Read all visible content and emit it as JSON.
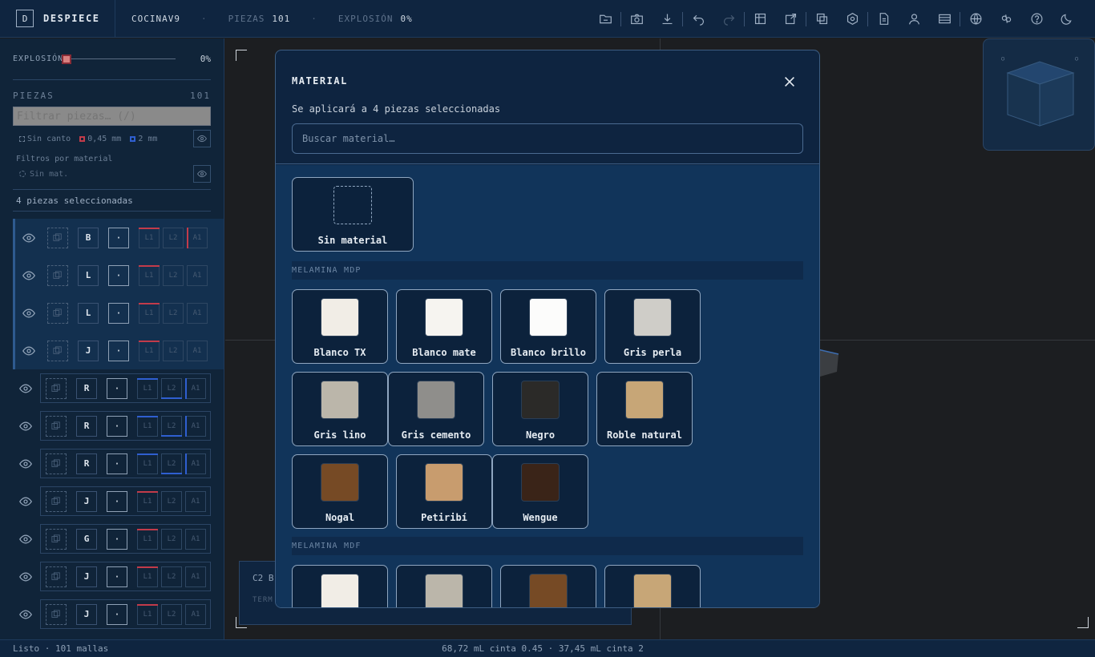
{
  "app": {
    "logo_letter": "D",
    "name": "DESPIECE"
  },
  "header": {
    "project": "COCINAV9",
    "pieces_label": "PIEZAS",
    "pieces_value": "101",
    "explode_label": "EXPLOSIÓN",
    "explode_value": "0%",
    "tools": [
      "folder-open-icon",
      "camera-icon",
      "download-icon",
      "undo-icon",
      "redo-icon",
      "table-icon",
      "edit-export-icon",
      "overlap-icon",
      "hexagon-settings-icon",
      "document-icon",
      "user-icon",
      "panel-icon",
      "globe-icon",
      "link-icon",
      "help-icon",
      "moon-icon"
    ]
  },
  "sidebar": {
    "explode_label": "EXPLOSIÓN",
    "explode_value": "0%",
    "explode_level": 0,
    "pieces_label": "PIEZAS",
    "pieces_count": "101",
    "filter_placeholder": "Filtrar piezas… (/)",
    "edge_none": "Sin canto",
    "edge_045": "0,45 mm",
    "edge_2": "2 mm",
    "material_filters_title": "Filtros por material",
    "no_material": "Sin mat.",
    "selected_text": "4 piezas seleccionadas",
    "edge_labels": {
      "l1": "L1",
      "l2": "L2",
      "a1": "A1"
    },
    "rows": [
      {
        "letter": "B",
        "dot": "·",
        "selected": true
      },
      {
        "letter": "L",
        "dot": "·",
        "selected": true
      },
      {
        "letter": "L",
        "dot": "·",
        "selected": true
      },
      {
        "letter": "J",
        "dot": "·",
        "selected": true
      },
      {
        "letter": "R",
        "dot": "·",
        "selected": false
      },
      {
        "letter": "R",
        "dot": "·",
        "selected": false
      },
      {
        "letter": "R",
        "dot": "·",
        "selected": false
      },
      {
        "letter": "J",
        "dot": "·",
        "selected": false
      },
      {
        "letter": "G",
        "dot": "·",
        "selected": false
      },
      {
        "letter": "J",
        "dot": "·",
        "selected": false
      },
      {
        "letter": "J",
        "dot": "·",
        "selected": false
      }
    ]
  },
  "viewport": {
    "info_title": "C2 B",
    "info_sub": "TERM"
  },
  "modal": {
    "title": "MATERIAL",
    "subtitle": "Se aplicará a 4 piezas seleccionadas",
    "search_placeholder": "Buscar material…",
    "no_material_label": "Sin material",
    "sections": [
      {
        "title": "MELAMINA MDP",
        "materials": [
          {
            "name": "Blanco TX",
            "color": "#f1ede6"
          },
          {
            "name": "Blanco mate",
            "color": "#f6f4f0"
          },
          {
            "name": "Blanco brillo",
            "color": "#fcfcfb"
          },
          {
            "name": "Gris perla",
            "color": "#cfcdc8"
          },
          {
            "name": "Gris lino",
            "color": "#bbb6aa"
          },
          {
            "name": "Gris cemento",
            "color": "#8f8e8b"
          },
          {
            "name": "Negro",
            "color": "#2b2a28"
          },
          {
            "name": "Roble natural",
            "color": "#c7a677"
          },
          {
            "name": "Nogal",
            "color": "#764a25"
          },
          {
            "name": "Petiribí",
            "color": "#c89c6e"
          },
          {
            "name": "Wengue",
            "color": "#3a2418"
          }
        ]
      },
      {
        "title": "MELAMINA MDF",
        "materials": [
          {
            "name": "",
            "color": "#f1ede6"
          },
          {
            "name": "",
            "color": "#bbb6aa"
          },
          {
            "name": "",
            "color": "#764a25"
          },
          {
            "name": "",
            "color": "#c7a677"
          }
        ]
      }
    ]
  },
  "status": {
    "left": "Listo · 101 mallas",
    "center": "68,72 mL cinta 0.45 · 37,45 mL cinta 2"
  },
  "colors": {
    "accent_red": "#c23b4a",
    "accent_blue": "#2f5fd0",
    "bg_navy": "#0f2540"
  }
}
